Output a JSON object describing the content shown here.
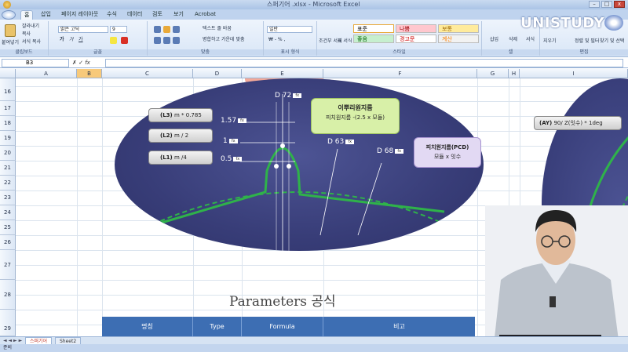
{
  "window": {
    "title": "스퍼기어 .xlsx - Microsoft Excel"
  },
  "winbtns": {
    "min": "–",
    "max": "□",
    "close": "x"
  },
  "tabs": [
    "홈",
    "삽입",
    "페이지 레이아웃",
    "수식",
    "데이터",
    "검토",
    "보기",
    "Acrobat"
  ],
  "ribbon": {
    "clipboard": {
      "paste": "붙여넣기",
      "cut": "잘라내기",
      "copy": "복사",
      "format_painter": "서식 복사",
      "label": "클립보드"
    },
    "font": {
      "name": "맑은 고딕",
      "size": "9",
      "label": "글꼴"
    },
    "align": {
      "wrap": "텍스트 줄 바꿈",
      "merge": "병합하고 가운데 맞춤",
      "label": "맞춤"
    },
    "number": {
      "format": "일반",
      "label": "표시 형식"
    },
    "cond_format": "조건부 서식",
    "table_format": "표 서식",
    "styles": {
      "normal": "표준",
      "bad": "나쁨",
      "neutral": "보통",
      "good": "좋음",
      "warning": "경고문",
      "calc": "계산",
      "label": "스타일"
    },
    "cells": {
      "insert": "삽입",
      "delete": "삭제",
      "format": "서식",
      "label": "셀"
    },
    "edit": {
      "clear": "지우기",
      "sort": "정렬 및 필터",
      "find": "찾기 및 선택",
      "label": "편집"
    }
  },
  "logo": "UNISTUDY",
  "formula_bar": {
    "name_box": "B3",
    "fx": "fx",
    "value": ""
  },
  "columns": [
    "A",
    "B",
    "C",
    "D",
    "E",
    "F",
    "G",
    "H",
    "I"
  ],
  "selected_column": "B",
  "rows": [
    "16",
    "17",
    "18",
    "19",
    "20",
    "21",
    "22",
    "23",
    "24",
    "25",
    "26",
    "27",
    "28",
    "29"
  ],
  "diagram": {
    "labels": [
      {
        "key": "(L3)",
        "text": "m * 0.785"
      },
      {
        "key": "(L2)",
        "text": "m / 2"
      },
      {
        "key": "(L1)",
        "text": "m /4"
      }
    ],
    "ay": {
      "key": "(AY)",
      "text": "90/ Z(잇수) * 1deg"
    },
    "dims": [
      "1.57",
      "1",
      "0.5"
    ],
    "diameters": [
      "D 72",
      "D 63",
      "D 68"
    ],
    "callout_root": {
      "title": "이뿌리원지름",
      "formula": "피치원지름 -(2.5 x 모듈)"
    },
    "callout_pcd": {
      "title": "피치원지름(PCD)",
      "formula": "모듈 x 잇수"
    },
    "fx_tag": "fx"
  },
  "parameters": {
    "title": "Parameters 공식",
    "headers": [
      "명칭",
      "Type",
      "Formula",
      "비고"
    ]
  },
  "sheets": [
    "스퍼기어",
    "Sheet2"
  ],
  "status": "준비",
  "colors": {
    "ellipse": "#383d78",
    "gear": "#2fb24a",
    "table_header": "#3d6eb3",
    "callout_green": "#d8f0a8",
    "callout_purple": "#e2d9f3"
  }
}
